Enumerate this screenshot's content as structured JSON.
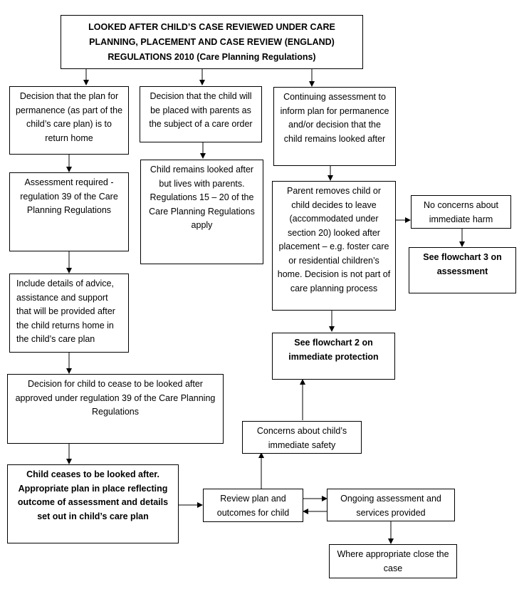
{
  "title": "LOOKED AFTER CHILD’S CASE REVIEWED UNDER CARE PLANNING, PLACEMENT AND CASE REVIEW (ENGLAND) REGULATIONS 2010 (Care Planning Regulations)",
  "nodes": {
    "decision_return_home": "Decision that the plan for permanence (as part of the child’s care plan) is to return home",
    "assessment_required": "Assessment required - regulation 39 of the Care Planning Regulations",
    "include_details": "Include details of advice, assistance and support that will be provided after the child returns home in the child’s care plan",
    "decision_cease": "Decision for child to cease to be looked after approved under regulation 39 of the Care Planning Regulations",
    "child_ceases": "Child ceases to be looked after. Appropriate plan in place reflecting outcome of assessment and details set out in child’s care plan",
    "decision_placed_parents": "Decision that the child will be placed with parents as the subject of a care order",
    "remains_looked_after": "Child remains looked after but lives with parents. Regulations 15 – 20 of the Care Planning Regulations apply",
    "continuing_assessment": "Continuing assessment to inform plan for permanence and/or decision that the child remains looked after",
    "parent_removes": "Parent removes child or child decides to leave (accommodated under section 20) looked after placement – e.g. foster care or residential children’s home. Decision is not part of care planning process",
    "no_concerns": "No concerns about immediate harm",
    "see_flowchart_3": "See flowchart 3 on assessment",
    "see_flowchart_2": "See flowchart 2 on immediate protection",
    "concerns_safety": "Concerns about child’s immediate safety",
    "review_plan": "Review plan and outcomes for child",
    "ongoing_assessment": "Ongoing assessment and services provided",
    "close_case": "Where appropriate close the case"
  },
  "edges": [
    [
      "title",
      "decision_return_home"
    ],
    [
      "title",
      "decision_placed_parents"
    ],
    [
      "title",
      "continuing_assessment"
    ],
    [
      "decision_return_home",
      "assessment_required"
    ],
    [
      "assessment_required",
      "include_details"
    ],
    [
      "include_details",
      "decision_cease"
    ],
    [
      "decision_cease",
      "child_ceases"
    ],
    [
      "child_ceases",
      "review_plan"
    ],
    [
      "decision_placed_parents",
      "remains_looked_after"
    ],
    [
      "continuing_assessment",
      "parent_removes"
    ],
    [
      "parent_removes",
      "no_concerns"
    ],
    [
      "no_concerns",
      "see_flowchart_3"
    ],
    [
      "parent_removes",
      "see_flowchart_2"
    ],
    [
      "review_plan",
      "concerns_safety"
    ],
    [
      "concerns_safety",
      "see_flowchart_2"
    ],
    [
      "review_plan",
      "ongoing_assessment"
    ],
    [
      "ongoing_assessment",
      "review_plan"
    ],
    [
      "ongoing_assessment",
      "close_case"
    ]
  ]
}
